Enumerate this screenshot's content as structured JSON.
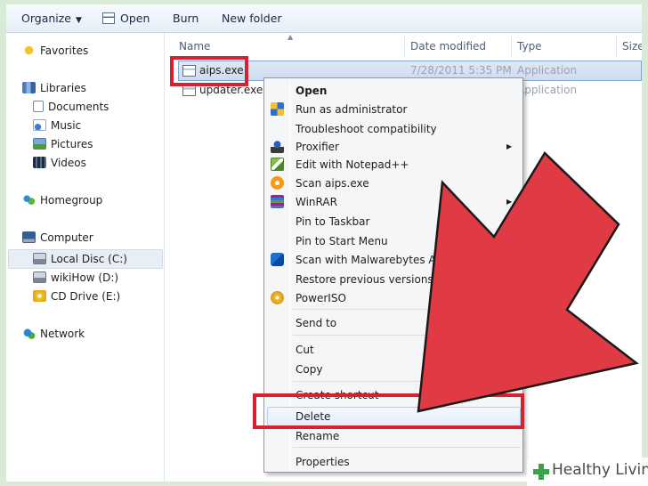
{
  "toolbar": {
    "organize": "Organize",
    "open": "Open",
    "burn": "Burn",
    "new_folder": "New folder"
  },
  "nav": {
    "favorites": "Favorites",
    "libraries": "Libraries",
    "documents": "Documents",
    "music": "Music",
    "pictures": "Pictures",
    "videos": "Videos",
    "homegroup": "Homegroup",
    "computer": "Computer",
    "local_disc": "Local Disc (C:)",
    "wikihow": "wikiHow (D:)",
    "cd_drive": "CD Drive (E:)",
    "network": "Network"
  },
  "columns": {
    "name": "Name",
    "date_modified": "Date modified",
    "type": "Type",
    "size": "Size"
  },
  "files": [
    {
      "name": "aips.exe",
      "date": "7/28/2011 5:35 PM",
      "type": "Application"
    },
    {
      "name": "updater.exe",
      "date": "",
      "type": "Application"
    }
  ],
  "context_menu": {
    "open": "Open",
    "run_as_admin": "Run as administrator",
    "troubleshoot": "Troubleshoot compatibility",
    "proxifier": "Proxifier",
    "edit_notepad": "Edit with Notepad++",
    "scan_aips": "Scan aips.exe",
    "winrar": "WinRAR",
    "pin_taskbar": "Pin to Taskbar",
    "pin_start": "Pin to Start Menu",
    "scan_malwarebytes": "Scan with Malwarebytes Anti-M",
    "restore_versions": "Restore previous versions",
    "poweriso": "PowerISO",
    "send_to": "Send to",
    "cut": "Cut",
    "copy": "Copy",
    "create_shortcut": "Create shortcut",
    "delete": "Delete",
    "rename": "Rename",
    "properties": "Properties"
  },
  "watermark": {
    "brand": "Healthy Living"
  },
  "colors": {
    "highlight_red": "#d8202e",
    "arrow_red": "#e03a45",
    "selection_blue": "#cddcef"
  }
}
